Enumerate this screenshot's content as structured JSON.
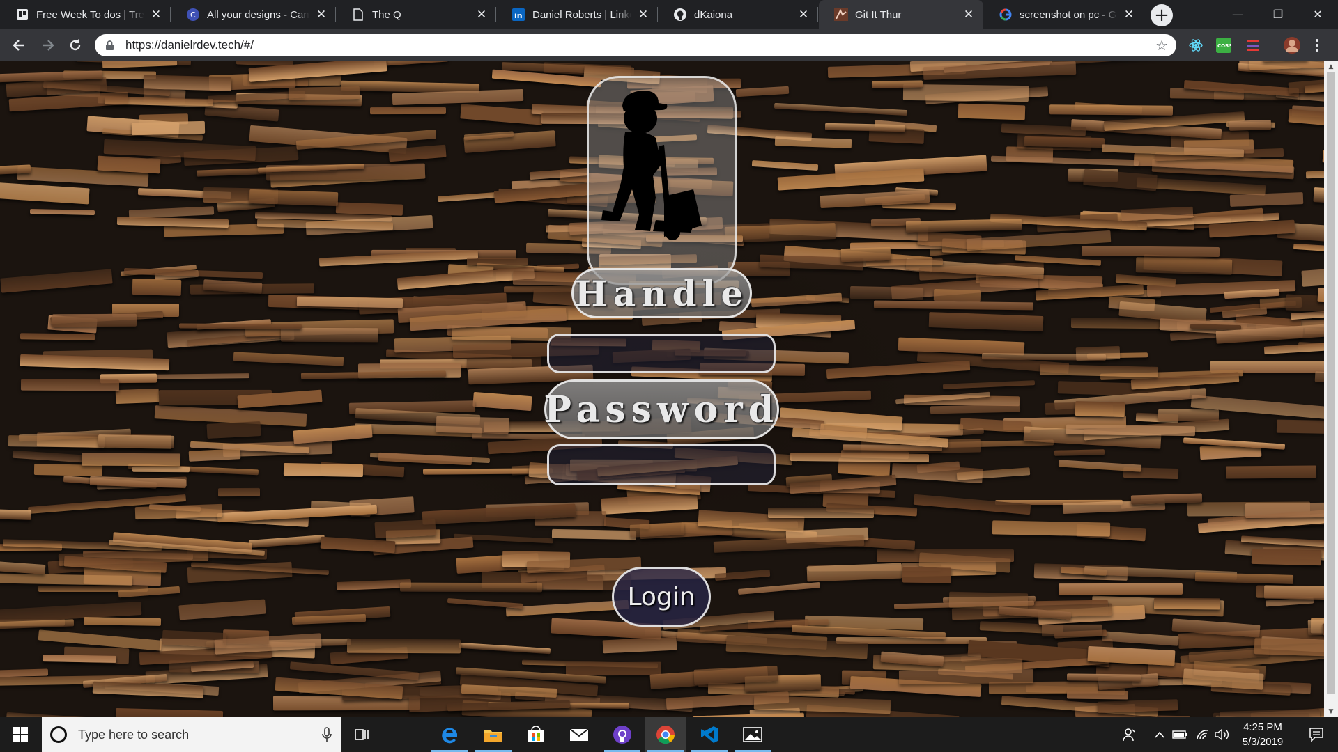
{
  "browser": {
    "tabs": [
      {
        "title": "Free Week To dos | Trello",
        "icon": "trello-icon"
      },
      {
        "title": "All your designs - Canva",
        "icon": "canva-icon"
      },
      {
        "title": "The Q",
        "icon": "page-icon"
      },
      {
        "title": "Daniel Roberts | LinkedIn",
        "icon": "linkedin-icon"
      },
      {
        "title": "dKaiona",
        "icon": "github-icon"
      },
      {
        "title": "Git It Thur",
        "icon": "site-icon"
      },
      {
        "title": "screenshot on pc - Google",
        "icon": "google-icon"
      }
    ],
    "active_tab_index": 5,
    "new_tab_label": "+",
    "address": "https://danielrdev.tech/#/",
    "window_controls": {
      "minimize": "—",
      "restore": "❐",
      "close": "✕"
    }
  },
  "page": {
    "handle_label": "Handle",
    "handle_value": "",
    "password_label": "Password",
    "password_value": "",
    "login_label": "Login"
  },
  "taskbar": {
    "search_placeholder": "Type here to search",
    "time": "4:25 PM",
    "date": "5/3/2019",
    "apps": [
      "task-view-icon",
      "edge-icon",
      "file-explorer-icon",
      "store-icon",
      "mail-icon",
      "github-desktop-icon",
      "chrome-icon",
      "vscode-icon",
      "photos-icon"
    ]
  },
  "colors": {
    "accent": "#76b9ed",
    "chrome_dark": "#202124",
    "toolbar": "#35363a"
  }
}
